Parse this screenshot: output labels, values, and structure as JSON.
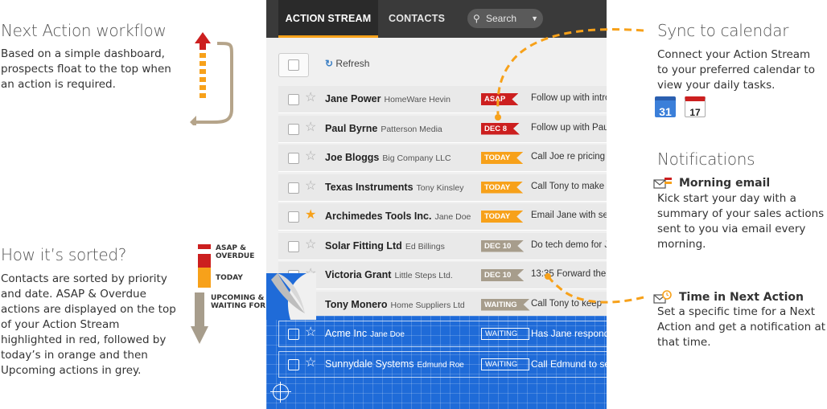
{
  "left": {
    "workflow_title": "Next Action workflow",
    "workflow_text": "Based on a simple dashboard, prospects float to the top when an action is required.",
    "sorted_title": "How it’s sorted?",
    "sorted_text": "Contacts are sorted by priority and date. ASAP & Overdue actions are displayed on the top of your Action Stream highlighted in red, followed by today’s in orange and then Upcoming actions in grey.",
    "legend": [
      {
        "label": "ASAP &\nOVERDUE",
        "color": "#cc1f1f"
      },
      {
        "label": "TODAY",
        "color": "#f7a11a"
      },
      {
        "label": "UPCOMING &\nWAITING FOR",
        "color": "#a79d8c"
      }
    ]
  },
  "app": {
    "tabs": [
      "ACTION STREAM",
      "CONTACTS"
    ],
    "search_placeholder": "Search",
    "refresh_label": "Refresh",
    "rows": [
      {
        "name": "Jane Power",
        "company": "HomeWare Hevin",
        "badge": "ASAP",
        "badge_color": "red",
        "action": "Follow up with intro",
        "starred": false
      },
      {
        "name": "Paul Byrne",
        "company": "Patterson Media",
        "badge": "DEC 8",
        "badge_color": "red",
        "action": "Follow up with Paul",
        "starred": false
      },
      {
        "name": "Joe Bloggs",
        "company": "Big Company LLC",
        "badge": "TODAY",
        "badge_color": "orange",
        "action": "Call Joe re pricing",
        "starred": false
      },
      {
        "name": "Texas Instruments",
        "company": "Tony Kinsley",
        "badge": "TODAY",
        "badge_color": "orange",
        "action": "Call Tony to make",
        "starred": false
      },
      {
        "name": "Archimedes Tools Inc.",
        "company": "Jane Doe",
        "badge": "TODAY",
        "badge_color": "orange",
        "action": "Email Jane with se",
        "starred": true
      },
      {
        "name": "Solar Fitting Ltd",
        "company": "Ed Billings",
        "badge": "DEC 10",
        "badge_color": "grey",
        "action": "Do tech demo for J",
        "starred": false
      },
      {
        "name": "Victoria Grant",
        "company": "Little Steps Ltd.",
        "badge": "DEC 10",
        "badge_color": "grey",
        "action": "13:35 Forward the",
        "starred": false
      },
      {
        "name": "Tony Monero",
        "company": "Home Suppliers Ltd",
        "badge": "WAITING",
        "badge_color": "grey",
        "action": "Call Tony to keep",
        "starred": false
      }
    ],
    "blueprint_rows": [
      {
        "name": "Acme Inc",
        "company": "Jane Doe",
        "badge": "WAITING",
        "action": "Has Jane respond"
      },
      {
        "name": "Sunnydale Systems",
        "company": "Edmund Roe",
        "badge": "WAITING",
        "action": "Call Edmund to se"
      }
    ]
  },
  "right": {
    "sync_title": "Sync to calendar",
    "sync_text": "Connect your Action Stream to your preferred calendar to view your daily tasks.",
    "gcal_day": "31",
    "ical_day": "17",
    "notif_title": "Notifications",
    "morning_title": "Morning email",
    "morning_text": "Kick start your day with a summary of your sales actions sent to you via email every morning.",
    "time_title": "Time in Next Action",
    "time_text": "Set a specific time for a Next Action and get a notification at that time."
  },
  "colors": {
    "asap": "#cc1f1f",
    "today": "#f7a11a",
    "upcoming": "#a79d8c",
    "accent": "#f7a11a",
    "blueprint": "#1f6bd8"
  }
}
